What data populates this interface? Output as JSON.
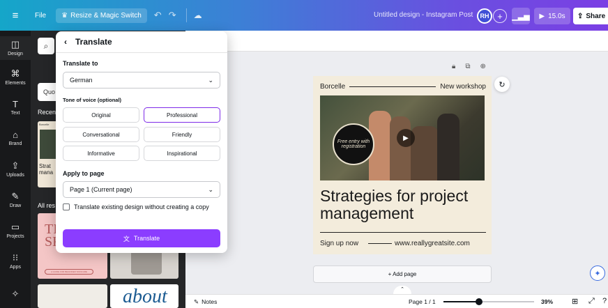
{
  "topbar": {
    "menu_icon": "≡",
    "file": "File",
    "resize": "Resize & Magic Switch",
    "title": "Untitled design - Instagram Post",
    "avatar": "RH",
    "play_time": "15.0s",
    "share": "Share"
  },
  "rail": [
    {
      "label": "Design",
      "icon": "◫"
    },
    {
      "label": "Elements",
      "icon": "⌘"
    },
    {
      "label": "Text",
      "icon": "T"
    },
    {
      "label": "Brand",
      "icon": "⌂"
    },
    {
      "label": "Uploads",
      "icon": "⇪"
    },
    {
      "label": "Draw",
      "icon": "✎"
    },
    {
      "label": "Projects",
      "icon": "▭"
    },
    {
      "label": "Apps",
      "icon": "⁝⁝"
    },
    {
      "label": "Magic",
      "icon": "✧"
    }
  ],
  "panel": {
    "quote_label": "Quo",
    "recent_label": "Recen",
    "all_results_label": "All res",
    "thumb_text": "Strat mana",
    "thumb_brand": "Borcelle",
    "thumb2_text": "TI GI SKIN",
    "thumb2_pill": "A GUIDE FOR BEGINNER SKINCARE",
    "thumb5_text": "about"
  },
  "translate": {
    "title": "Translate",
    "translate_to_label": "Translate to",
    "language": "German",
    "tone_label": "Tone of voice (optional)",
    "tones": [
      "Original",
      "Professional",
      "Conversational",
      "Friendly",
      "Informative",
      "Inspirational"
    ],
    "selected_tone": "Professional",
    "apply_label": "Apply to page",
    "page_option": "Page 1 (Current page)",
    "checkbox_label": "Translate existing design without creating a copy",
    "button": "Translate"
  },
  "design": {
    "brand": "Borcelle",
    "workshop": "New workshop",
    "circle_text": "Free entry with registration",
    "headline": "Strategies for project management",
    "signup": "Sign up now",
    "url": "www.reallygreatsite.com"
  },
  "canvas": {
    "add_page": "+ Add page"
  },
  "footer": {
    "notes": "Notes",
    "page": "Page 1 / 1",
    "zoom": "39%",
    "zoom_fraction": 0.39
  },
  "colors": {
    "accent": "#8b3dff",
    "brand_gradient_start": "#15a6c9",
    "brand_gradient_end": "#7b3fe4",
    "design_bg": "#f3ecdc"
  }
}
